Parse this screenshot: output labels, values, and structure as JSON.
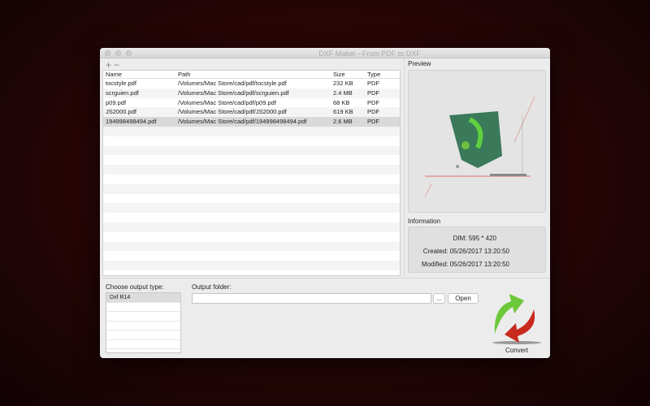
{
  "window": {
    "title": "DXF Maker - From PDF to DXF"
  },
  "toolbar": {
    "add": "+",
    "remove": "−"
  },
  "table": {
    "headers": [
      "Name",
      "Path",
      "Size",
      "Type"
    ],
    "rows": [
      [
        "tocstyle.pdf",
        "/Volumes/Mac Store/cad/pdf/tocstyle.pdf",
        "232 KB",
        "PDF"
      ],
      [
        "scrguien.pdf",
        "/Volumes/Mac Store/cad/pdf/scrguien.pdf",
        "2.4 MB",
        "PDF"
      ],
      [
        "p09.pdf",
        "/Volumes/Mac Store/cad/pdf/p09.pdf",
        "68 KB",
        "PDF"
      ],
      [
        "JS2000.pdf",
        "/Volumes/Mac Store/cad/pdf/JS2000.pdf",
        "619 KB",
        "PDF"
      ],
      [
        "194998498494.pdf",
        "/Volumes/Mac Store/cad/pdf/194998498494.pdf",
        "2.6 MB",
        "PDF"
      ]
    ],
    "selected_index": 4
  },
  "preview": {
    "label": "Preview"
  },
  "information": {
    "label": "Information",
    "dim": "DIM: 595 * 420",
    "created": "Created: 05/26/2017 13:20:50",
    "modified": "Modified: 05/26/2017 13:20:50"
  },
  "output": {
    "type_label": "Choose output type:",
    "types": [
      "Dxf R14"
    ],
    "folder_label": "Output folder:",
    "folder_value": "",
    "browse": "...",
    "open": "Open",
    "convert": "Convert"
  }
}
